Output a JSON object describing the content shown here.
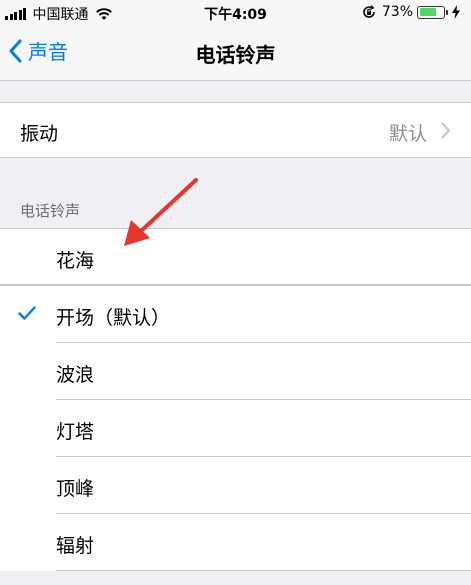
{
  "status_bar": {
    "carrier": "中国联通",
    "time": "下午4:09",
    "battery_percent": "73%",
    "battery_level": 0.73
  },
  "nav": {
    "back_label": "声音",
    "title": "电话铃声"
  },
  "vibration": {
    "label": "振动",
    "value": "默认"
  },
  "ringtones": {
    "section_header": "电话铃声",
    "items": [
      {
        "label": "花海",
        "checked": false
      },
      {
        "label": "开场（默认）",
        "checked": true
      },
      {
        "label": "波浪",
        "checked": false
      },
      {
        "label": "灯塔",
        "checked": false
      },
      {
        "label": "顶峰",
        "checked": false
      },
      {
        "label": "辐射",
        "checked": false
      }
    ]
  },
  "colors": {
    "accent": "#007aff",
    "annotation_arrow": "#e8352c",
    "battery_fill": "#4cd964"
  }
}
